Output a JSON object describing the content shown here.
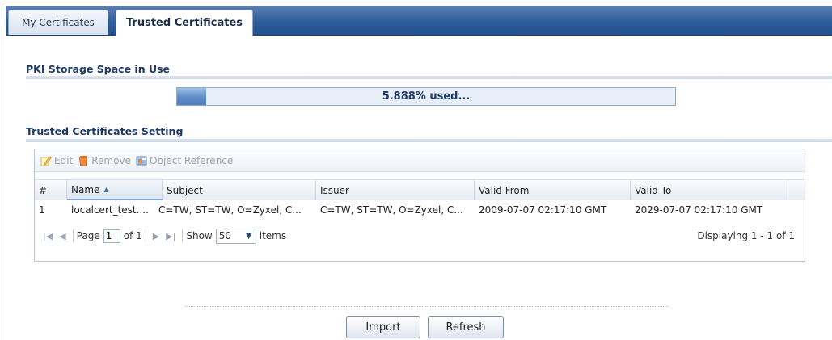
{
  "tabs": [
    {
      "label": "My Certificates"
    },
    {
      "label": "Trusted Certificates"
    }
  ],
  "storage": {
    "title": "PKI Storage Space in Use",
    "usage_text": "5.888% used...",
    "usage_fraction": 0.05888
  },
  "setting": {
    "title": "Trusted Certificates Setting"
  },
  "toolbar": {
    "edit_label": "Edit",
    "remove_label": "Remove",
    "object_reference_label": "Object Reference",
    "icons": [
      "edit-icon",
      "remove-icon",
      "object-reference-icon"
    ]
  },
  "table": {
    "columns": [
      "#",
      "Name",
      "Subject",
      "Issuer",
      "Valid From",
      "Valid To"
    ],
    "sort_indicator": "▲",
    "rows": [
      {
        "index": "1",
        "name": "localcert_test....",
        "subject": "C=TW, ST=TW, O=Zyxel, C...",
        "issuer": "C=TW, ST=TW, O=Zyxel, C...",
        "valid_from": "2009-07-07 02:17:10 GMT",
        "valid_to": "2029-07-07 02:17:10 GMT"
      }
    ]
  },
  "pager": {
    "page_label": "Page",
    "page_value": "1",
    "of_label": "of 1",
    "show_label": "Show",
    "show_value": "50",
    "items_label": "items",
    "displaying": "Displaying 1 - 1 of 1"
  },
  "buttons": {
    "import_label": "Import",
    "refresh_label": "Refresh"
  },
  "colors": {
    "tabbar": "#2f5c9a",
    "section_title": "#1d3a66",
    "progress_fill": "#5d8cc7"
  }
}
